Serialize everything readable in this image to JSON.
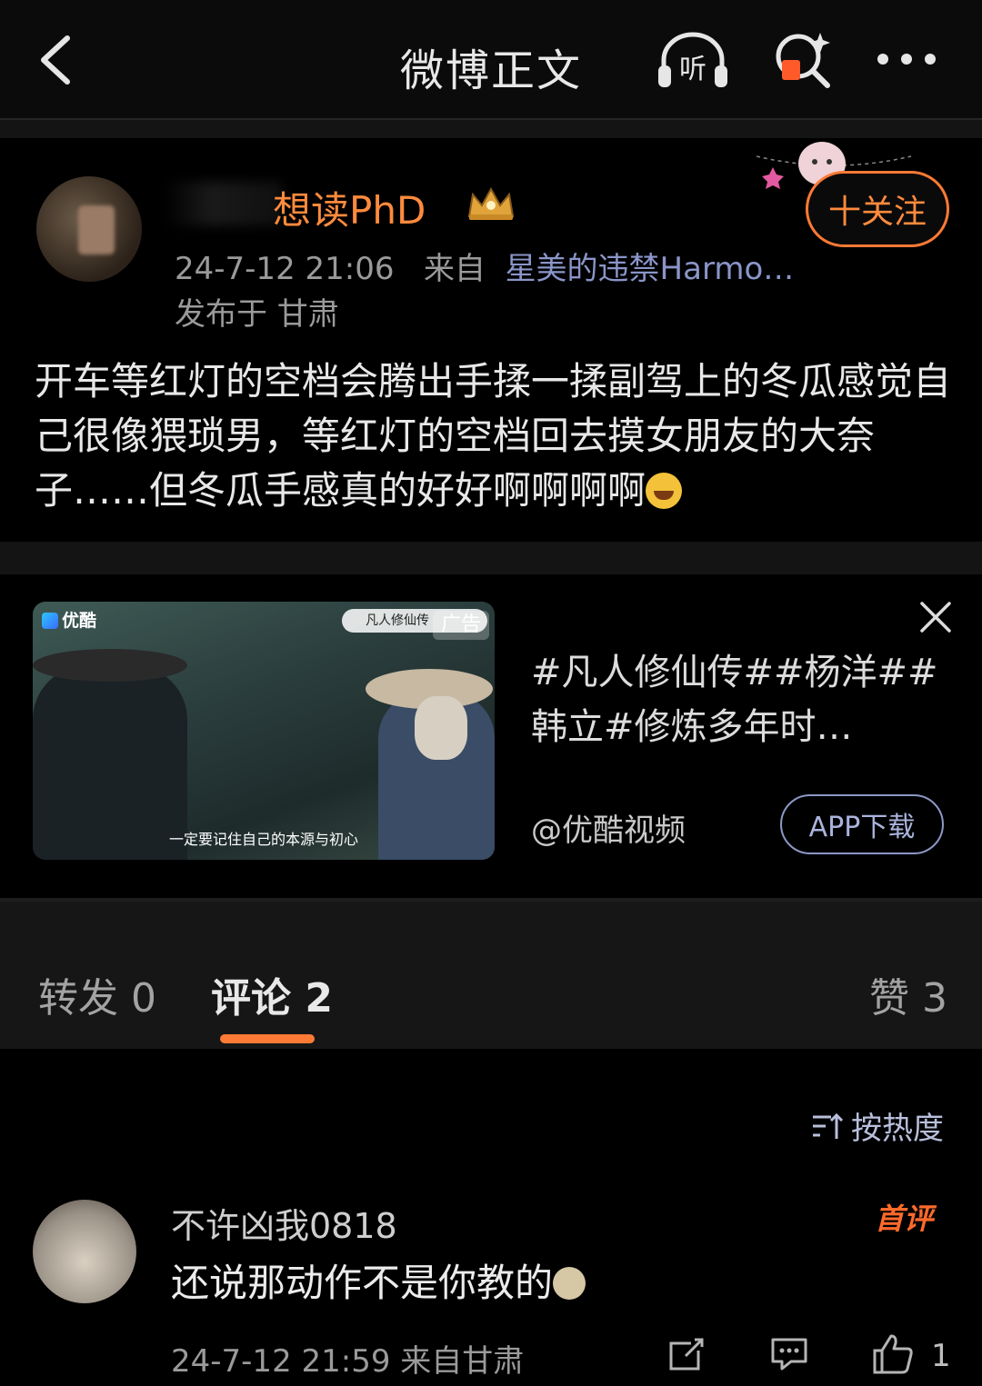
{
  "header": {
    "title": "微博正文",
    "listen_label": "听"
  },
  "post": {
    "username": "想读PhD",
    "time": "24-7-12 21:06",
    "from_label": "来自",
    "source": "星美的违禁Harmo…",
    "location": "发布于 甘肃",
    "follow_label": "十关注",
    "content": "开车等红灯的空档会腾出手揉一揉副驾上的冬瓜感觉自己很像猥琐男，等红灯的空档回去摸女朋友的大奈子……但冬瓜手感真的好好啊啊啊啊"
  },
  "ad": {
    "brand": "优酷",
    "search_text": "凡人修仙传",
    "ad_tag": "广告",
    "subtitle": "一定要记住自己的本源与初心",
    "title": "#凡人修仙传##杨洋##韩立#修炼多年时…",
    "source": "@优酷视频",
    "button": "APP下载"
  },
  "tabs": {
    "repost": "转发 0",
    "comment": "评论 2",
    "like": "赞 3"
  },
  "comments": {
    "sort_label": "按热度",
    "items": [
      {
        "user": "不许凶我0818",
        "badge": "首评",
        "text": "还说那动作不是你教的",
        "meta": "24-7-12 21:59 来自甘肃",
        "likes": "1"
      }
    ]
  }
}
